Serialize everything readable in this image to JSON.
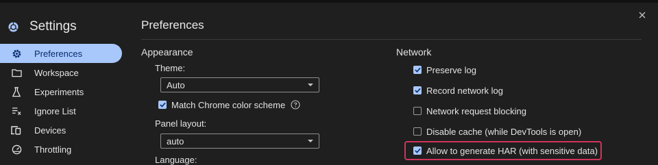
{
  "sidebar": {
    "title": "Settings",
    "items": [
      {
        "label": "Preferences",
        "icon": "gear-icon",
        "active": true
      },
      {
        "label": "Workspace",
        "icon": "folder-icon"
      },
      {
        "label": "Experiments",
        "icon": "flask-icon"
      },
      {
        "label": "Ignore List",
        "icon": "ignore-list-icon"
      },
      {
        "label": "Devices",
        "icon": "devices-icon"
      },
      {
        "label": "Throttling",
        "icon": "speedometer-icon"
      }
    ]
  },
  "main": {
    "title": "Preferences",
    "appearance": {
      "title": "Appearance",
      "theme_label": "Theme:",
      "theme_value": "Auto",
      "match_chrome_label": "Match Chrome color scheme",
      "panel_layout_label": "Panel layout:",
      "panel_layout_value": "auto",
      "language_label": "Language:"
    },
    "network": {
      "title": "Network",
      "options": [
        {
          "label": "Preserve log",
          "checked": true
        },
        {
          "label": "Record network log",
          "checked": true
        },
        {
          "label": "Network request blocking",
          "checked": false
        },
        {
          "label": "Disable cache (while DevTools is open)",
          "checked": false
        },
        {
          "label": "Allow to generate HAR (with sensitive data)",
          "checked": true,
          "highlighted": true
        }
      ]
    }
  },
  "colors": {
    "background": "#1f1f1f",
    "accent": "#a8c7fa",
    "highlight_border": "#d1345b"
  }
}
